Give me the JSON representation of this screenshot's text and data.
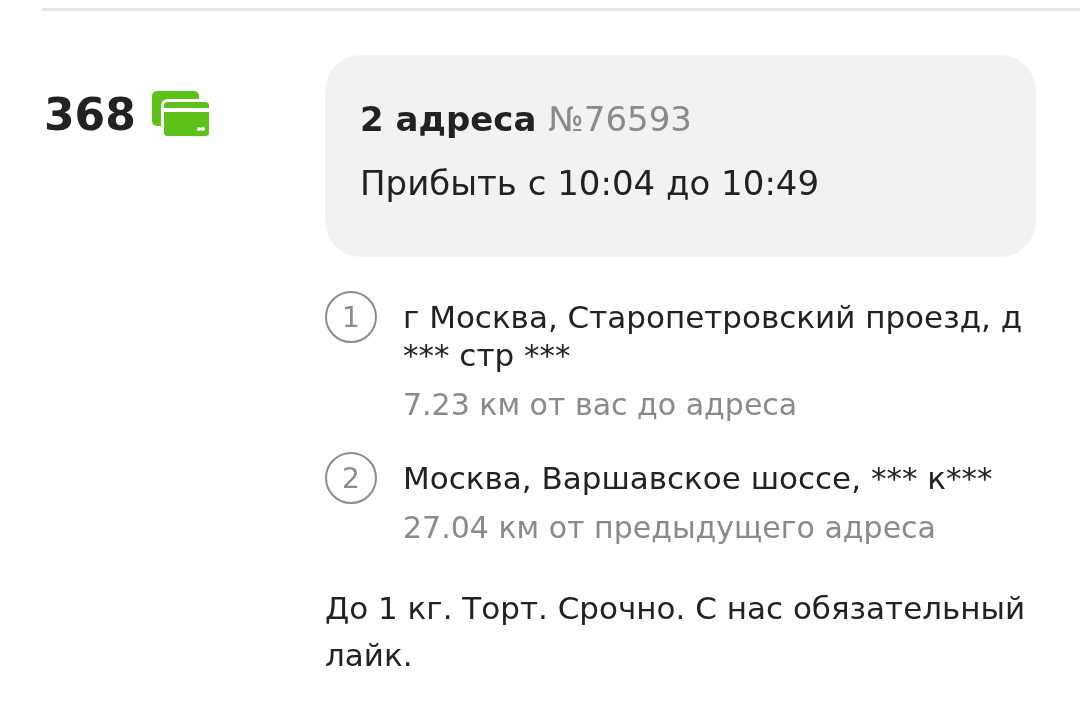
{
  "price": {
    "amount": "368"
  },
  "order": {
    "title": "2 адреса",
    "number": "№76593",
    "arrival": "Прибыть с 10:04 до 10:49"
  },
  "addresses": [
    {
      "number": "1",
      "address": "г Москва, Старопетровский проезд, д *** стр ***",
      "distance": "7.23 км от вас до адреса"
    },
    {
      "number": "2",
      "address": "Москва, Варшавское шоссе, *** к***",
      "distance": "27.04 км от предыдущего адреса"
    }
  ],
  "note": "До 1 кг. Торт. Срочно. С нас обязательный лайк."
}
